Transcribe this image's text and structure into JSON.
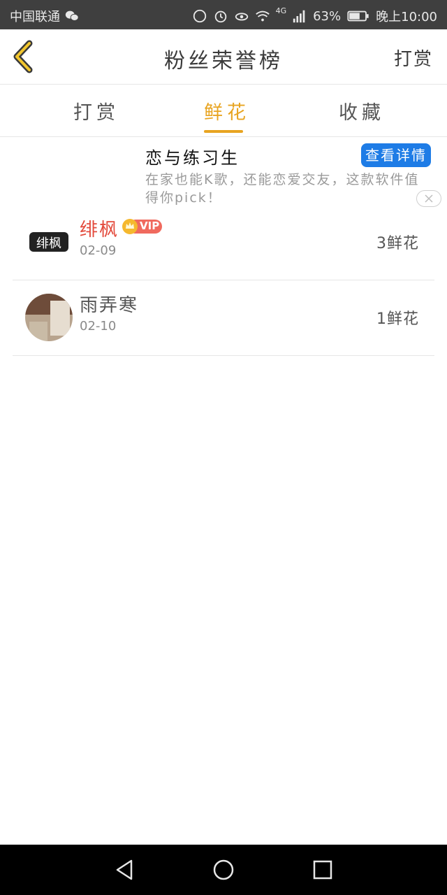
{
  "status_bar": {
    "carrier": "中国联通",
    "network": "4G",
    "battery": "63%",
    "time": "晚上10:00"
  },
  "header": {
    "title": "粉丝荣誉榜",
    "right_action": "打赏"
  },
  "tabs": [
    {
      "label": "打赏"
    },
    {
      "label": "鲜花"
    },
    {
      "label": "收藏"
    }
  ],
  "active_tab_index": 1,
  "ad": {
    "title": "恋与练习生",
    "button": "查看详情",
    "description": "在家也能K歌，还能恋爱交友，这款软件值得你pick！"
  },
  "list": [
    {
      "name": "绯枫",
      "vip_label": "VIP",
      "date": "02-09",
      "count": "3鲜花",
      "avatar_text": "绯枫"
    },
    {
      "name": "雨弄寒",
      "date": "02-10",
      "count": "1鲜花"
    }
  ],
  "colors": {
    "accent": "#e8a421",
    "vip_name": "#e34a3c",
    "ad_button": "#1e7ce6"
  }
}
